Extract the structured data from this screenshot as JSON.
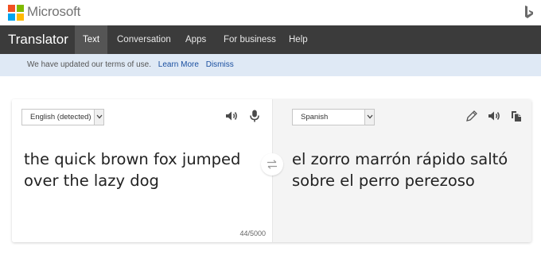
{
  "brand": {
    "name": "Microsoft",
    "colors": {
      "red": "#f25022",
      "green": "#7fba00",
      "blue": "#00a4ef",
      "yellow": "#ffb900"
    }
  },
  "nav": {
    "title": "Translator",
    "tabs": [
      {
        "label": "Text",
        "active": true
      },
      {
        "label": "Conversation",
        "active": false
      },
      {
        "label": "Apps",
        "active": false
      },
      {
        "label": "For business",
        "active": false
      },
      {
        "label": "Help",
        "active": false
      }
    ]
  },
  "notice": {
    "message": "We have updated our terms of use.",
    "learn_more": "Learn More",
    "dismiss": "Dismiss"
  },
  "source": {
    "language": "English (detected)",
    "text": "the quick brown fox jumped over the lazy dog",
    "char_count": "44/5000",
    "icons": [
      "speaker-icon",
      "microphone-icon"
    ]
  },
  "target": {
    "language": "Spanish",
    "text": "el zorro marrón rápido saltó sobre el perro perezoso",
    "icons": [
      "pencil-icon",
      "speaker-icon",
      "copy-icon"
    ]
  },
  "swap": {
    "icon": "swap-arrows-icon"
  }
}
